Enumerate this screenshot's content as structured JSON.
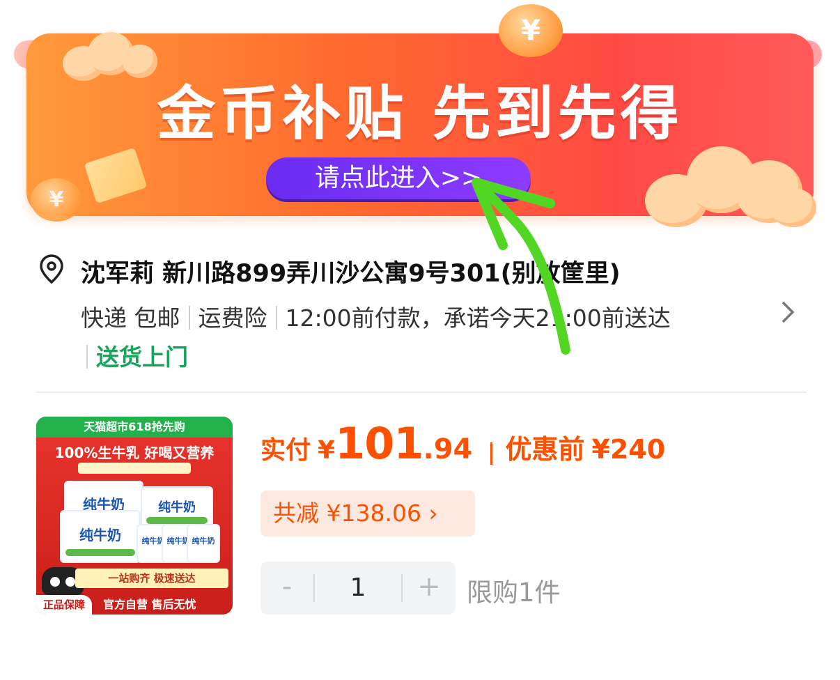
{
  "banner": {
    "title": "金币补贴 先到先得",
    "button_label": "请点此进入>>",
    "coin_symbol": "¥"
  },
  "address": {
    "recipient_and_address": "沈军莉 新川路899弄川沙公寓9号301(别放筐里)",
    "tags": [
      "快递 包邮",
      "运费险",
      "12:00前付款，承诺今天21:00前送达"
    ],
    "delivery_tag": "送货上门"
  },
  "product": {
    "image": {
      "top_strip": "天猫超市618抢先购",
      "headline": "100%生牛乳 好喝又营养",
      "box_label": "纯牛奶",
      "promo_strip": "一站购齐 极速送达",
      "bottom_text": "官方自营 售后无忧",
      "badge": "正品保障"
    },
    "price_label": "实付",
    "currency": "¥",
    "price_int": "101",
    "price_dec": ".94",
    "original_label": "优惠前",
    "original_price": "¥240",
    "discount_text": "共减 ¥138.06 ›",
    "quantity": "1",
    "minus": "-",
    "plus": "+",
    "limit_text": "限购1件"
  },
  "colors": {
    "accent": "#ff5000",
    "delivery_green": "#1aa35c",
    "banner_button": "#7a33f5",
    "annotation_arrow": "#52d624"
  }
}
